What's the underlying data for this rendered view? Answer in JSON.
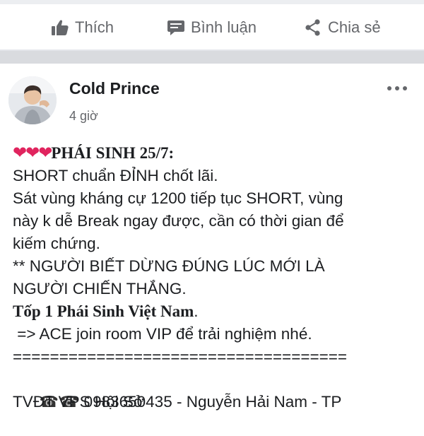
{
  "actions": {
    "like_label": "Thích",
    "comment_label": "Bình luận",
    "share_label": "Chia sẻ"
  },
  "post": {
    "author": "Cold Prince",
    "time": "4 giờ",
    "lines": [
      {
        "hearts": "❤❤❤",
        "text": "PHÁI SINH 25/7:"
      },
      {
        "text": "SHORT chuẩn ĐỈNH chốt lãi."
      },
      {
        "text": "Sát vùng kháng cự 1200 tiếp tục SHORT, vùng"
      },
      {
        "text": "này k dễ Break ngay được, cần có thời gian để"
      },
      {
        "text": "kiếm chứng."
      },
      {
        "text": "** NGƯỜI BIẾT DỪNG ĐÚNG LÚC MỚI LÀ"
      },
      {
        "text": "NGƯỜI CHIẾN THẮNG."
      },
      {
        "bold": "Tốp 1 Phái Sinh Việt Nam",
        "suffix": "."
      },
      {
        "text": " => ACE join room VIP để trải nghiệm nhé."
      },
      {
        "text": "===================================="
      },
      {
        "phones": "☎☎",
        "text": " 0983650435 - Nguyễn Hải Nam - TP"
      },
      {
        "text": "TVĐT VPS Hội Sở"
      }
    ]
  },
  "colors": {
    "text": "#1c1e21",
    "muted": "#65676b",
    "separator": "#d9dbdf",
    "heart": "#e0245e"
  }
}
